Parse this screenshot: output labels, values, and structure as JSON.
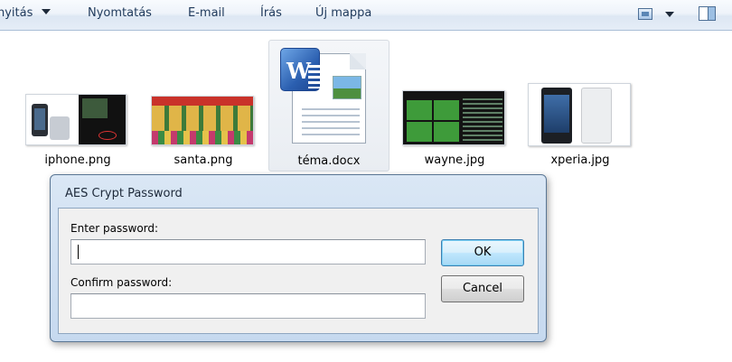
{
  "toolbar": {
    "items": [
      {
        "label": "nyitás"
      },
      {
        "label": "Nyomtatás"
      },
      {
        "label": "E-mail"
      },
      {
        "label": "Írás"
      },
      {
        "label": "Új mappa"
      }
    ],
    "view_icon": "view-options-icon",
    "pane_icon": "preview-pane-icon"
  },
  "files": [
    {
      "name": "iphone.png",
      "icon": "image-thumbnail"
    },
    {
      "name": "santa.png",
      "icon": "image-thumbnail"
    },
    {
      "name": "téma.docx",
      "icon": "word-document-icon",
      "selected": true
    },
    {
      "name": "wayne.jpg",
      "icon": "image-thumbnail"
    },
    {
      "name": "xperia.jpg",
      "icon": "image-thumbnail"
    }
  ],
  "dialog": {
    "title": "AES Crypt Password",
    "enter_label": "Enter password:",
    "enter_value": "",
    "confirm_label": "Confirm password:",
    "confirm_value": "",
    "ok_label": "OK",
    "cancel_label": "Cancel"
  },
  "colors": {
    "toolbar_text": "#1e395b",
    "dialog_frame": "#c6d9ef",
    "default_button": "#bee6fd"
  }
}
